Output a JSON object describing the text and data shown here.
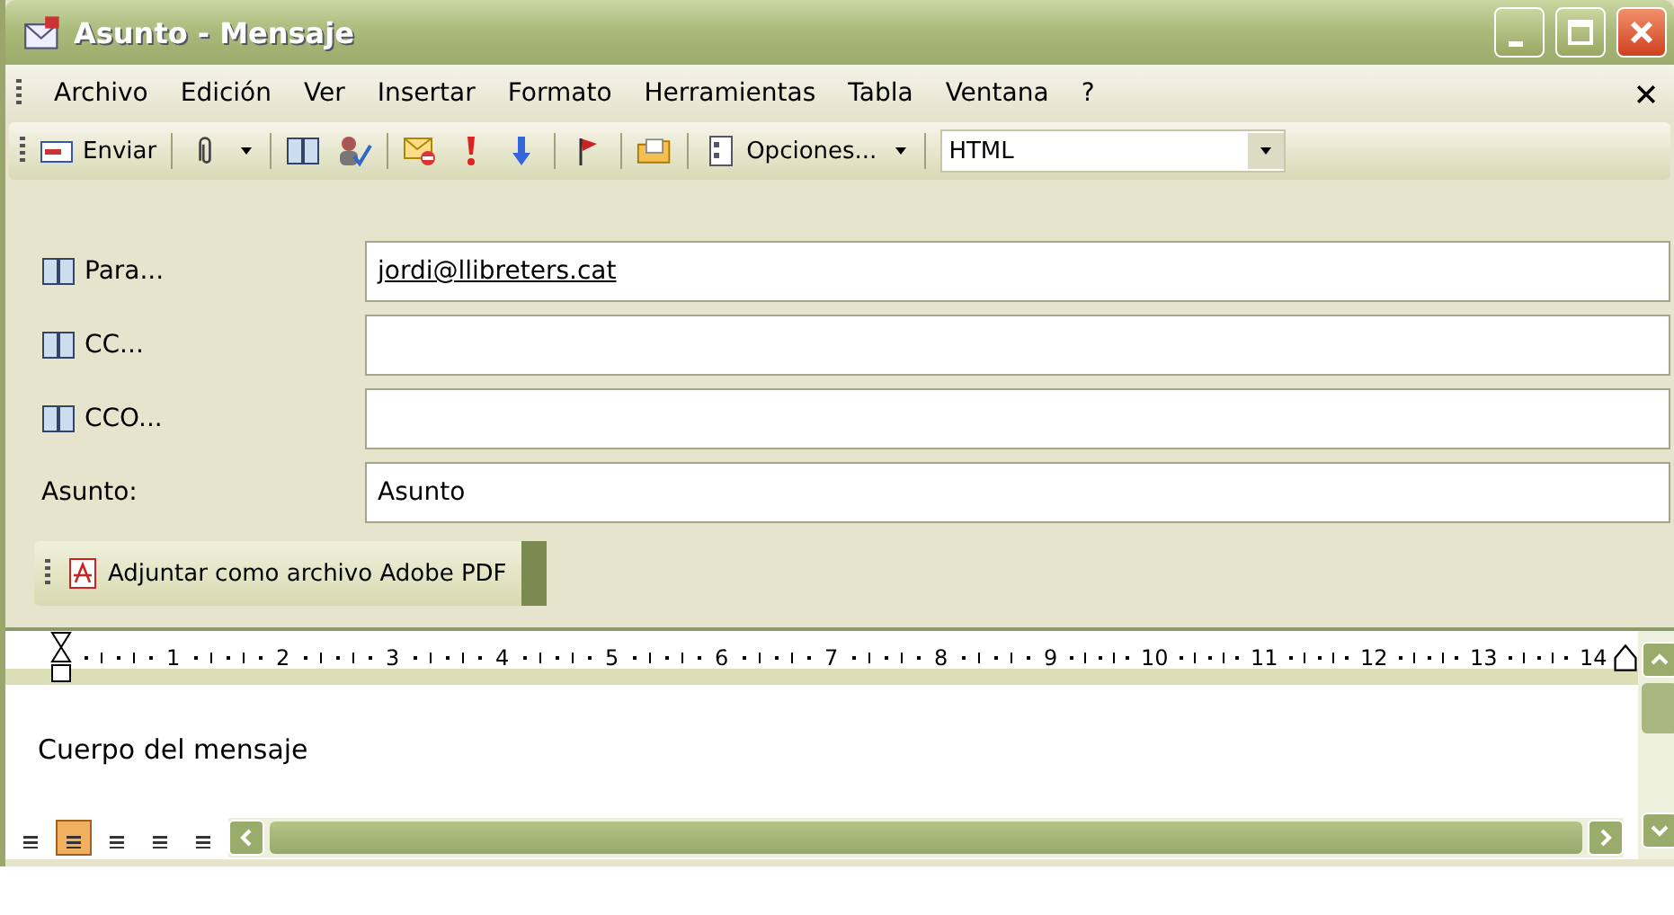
{
  "window": {
    "title": "Asunto - Mensaje"
  },
  "menu": [
    "Archivo",
    "Edición",
    "Ver",
    "Insertar",
    "Formato",
    "Herramientas",
    "Tabla",
    "Ventana",
    "?"
  ],
  "toolbar": [
    {
      "kind": "send",
      "label": "Enviar"
    },
    {
      "kind": "sep"
    },
    {
      "kind": "attach"
    },
    {
      "kind": "drop"
    },
    {
      "kind": "sep"
    },
    {
      "kind": "book"
    },
    {
      "kind": "check"
    },
    {
      "kind": "sep"
    },
    {
      "kind": "signature"
    },
    {
      "kind": "high"
    },
    {
      "kind": "low"
    },
    {
      "kind": "sep"
    },
    {
      "kind": "flag"
    },
    {
      "kind": "sep"
    },
    {
      "kind": "folder"
    },
    {
      "kind": "sep"
    },
    {
      "kind": "options",
      "label": "Opciones..."
    },
    {
      "kind": "drop"
    },
    {
      "kind": "sep"
    },
    {
      "kind": "combo",
      "label": "HTML"
    }
  ],
  "header_fields": [
    {
      "label": "Para...",
      "book": true,
      "value": "jordi@llibreters.cat",
      "link": true
    },
    {
      "label": "CC...",
      "book": true
    },
    {
      "label": "CCO...",
      "book": true
    },
    {
      "label": "Asunto:",
      "book": false,
      "value": "Asunto",
      "link": false
    }
  ],
  "pdf_toolbar": {
    "label": "Adjuntar como archivo Adobe PDF"
  },
  "ruler": [
    "1",
    "2",
    "3",
    "4",
    "5",
    "6",
    "7",
    "8",
    "9",
    "10",
    "11",
    "12",
    "13",
    "14"
  ],
  "body": "Cuerpo del mensaje",
  "view_buttons": [
    {
      "selected": false
    },
    {
      "selected": true
    },
    {
      "selected": false
    },
    {
      "selected": false
    },
    {
      "selected": false
    }
  ]
}
